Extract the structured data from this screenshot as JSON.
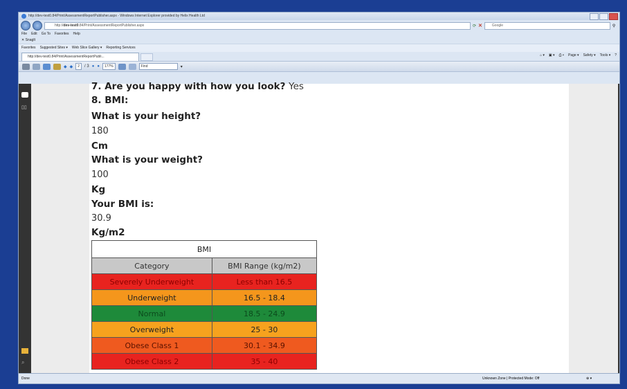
{
  "browser": {
    "title": "http://dev-test0.84/Print/AssessmentReportPublisher.aspx - Windows Internet Explorer provided by Helix Health Ltd",
    "address_prefix": "http://",
    "address_host": "dev-test0",
    "address_rest": ".84/Print/AssessmentReportPublisher.aspx",
    "search_placeholder": "Google",
    "menu": [
      "File",
      "Edit",
      "Go To",
      "Favorites",
      "Help"
    ],
    "snagit": "SnagIt",
    "favorites": [
      "Favorites",
      "Suggested Sites ▾",
      "Web Slice Gallery ▾",
      "Reporting Services"
    ],
    "tab_label": "http://dev-test0.84/Print/AssessmentReportPubli...",
    "command_bar": [
      "Page ▾",
      "Safety ▾",
      "Tools ▾"
    ]
  },
  "pdf_toolbar": {
    "page_current": "2",
    "page_total": "/ 3",
    "zoom": "177%",
    "find_placeholder": "Find"
  },
  "document": {
    "q7": "7. Are you happy with how you look?",
    "q7_answer": "Yes",
    "q8": "8. BMI:",
    "height_q": "What is your height?",
    "height_val": "180",
    "height_unit": "Cm",
    "weight_q": "What is your weight?",
    "weight_val": "100",
    "weight_unit": "Kg",
    "bmi_q": "Your BMI is:",
    "bmi_val": "30.9",
    "bmi_unit": "Kg/m2"
  },
  "bmi_table": {
    "title": "BMI",
    "headers": [
      "Category",
      "BMI Range (kg/m2)"
    ],
    "rows": [
      {
        "category": "Severely Underweight",
        "range": "Less than 16.5",
        "color": "#e8231f",
        "text": "#8b0000"
      },
      {
        "category": "Underweight",
        "range": "16.5 - 18.4",
        "color": "#f4961c",
        "text": "#222222"
      },
      {
        "category": "Normal",
        "range": "18.5 - 24.9",
        "color": "#1e8a3a",
        "text": "#0c4a1c"
      },
      {
        "category": "Overweight",
        "range": "25 - 30",
        "color": "#f6a21e",
        "text": "#222222"
      },
      {
        "category": "Obese Class 1",
        "range": "30.1 - 34.9",
        "color": "#ef5a1f",
        "text": "#5a1200"
      },
      {
        "category": "Obese Class 2",
        "range": "35 - 40",
        "color": "#e8231f",
        "text": "#8b0000"
      }
    ]
  },
  "status": {
    "left": "Done",
    "zone": "Unknown Zone | Protected Mode: Off",
    "zoom": "⊕ ▾"
  }
}
